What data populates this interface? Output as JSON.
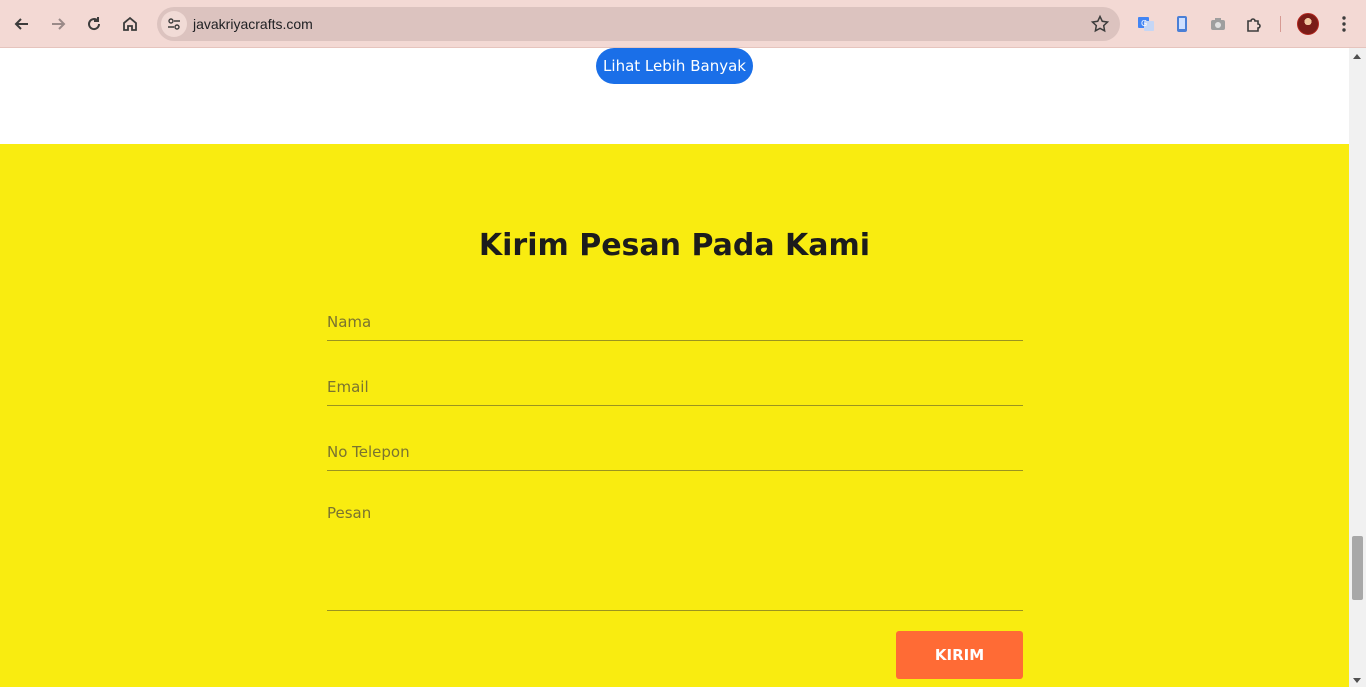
{
  "browser": {
    "url": "javakriyacrafts.com",
    "accent_color": "#f3d9d4"
  },
  "page": {
    "more_button_label": "Lihat Lebih Banyak",
    "contact": {
      "title": "Kirim Pesan Pada Kami",
      "name_placeholder": "Nama",
      "email_placeholder": "Email",
      "phone_placeholder": "No Telepon",
      "message_placeholder": "Pesan",
      "submit_label": "KIRIM",
      "background_color": "#f9ec10",
      "submit_color": "#ff6b35"
    }
  }
}
